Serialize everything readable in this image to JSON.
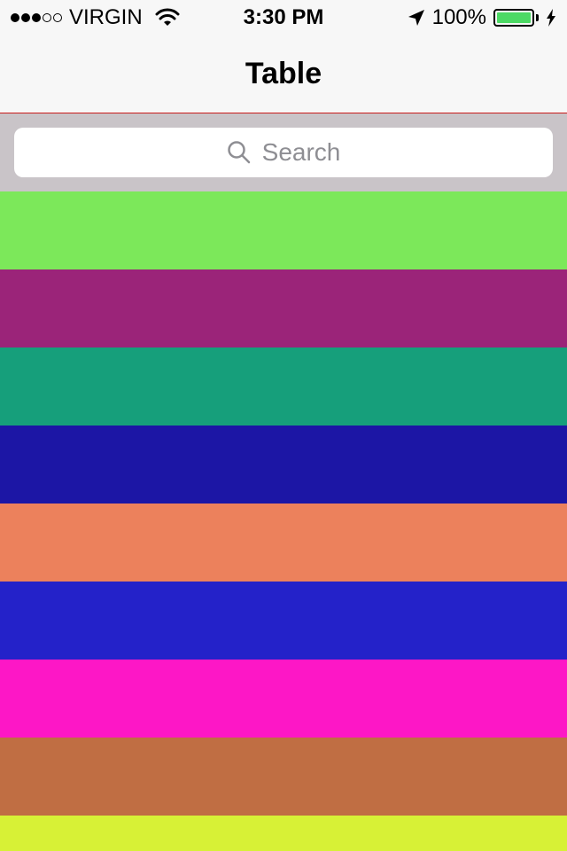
{
  "status_bar": {
    "signal": {
      "filled": 3,
      "total": 5
    },
    "carrier": "VIRGIN",
    "time": "3:30 PM",
    "battery_percent": "100%",
    "battery_level": 1.0,
    "icons": [
      "wifi-icon",
      "location-arrow-icon",
      "battery-icon",
      "charging-bolt-icon"
    ]
  },
  "nav": {
    "title": "Table"
  },
  "search": {
    "placeholder": "Search",
    "icon": "search-icon"
  },
  "rows": [
    {
      "color": "#7ce85a"
    },
    {
      "color": "#9b2479"
    },
    {
      "color": "#169f7b"
    },
    {
      "color": "#1c16a5"
    },
    {
      "color": "#ec815c"
    },
    {
      "color": "#2422c9"
    },
    {
      "color": "#fd17c6"
    },
    {
      "color": "#c06e43"
    },
    {
      "color": "#d7f136"
    }
  ],
  "colors": {
    "status_bar_bg": "#f7f7f7",
    "nav_separator": "#c91a1a",
    "search_bar_bg": "#c9c4c8",
    "battery_fill": "#4cd964"
  }
}
